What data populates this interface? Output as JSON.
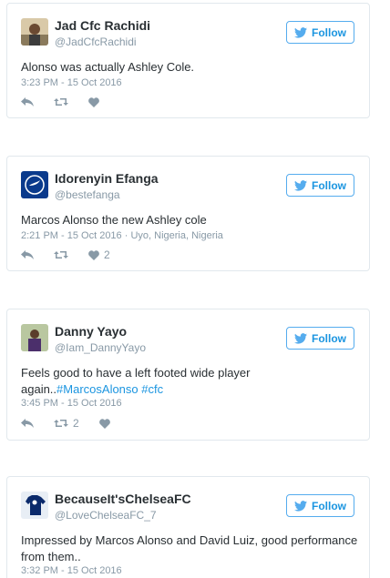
{
  "follow_label": "Follow",
  "colors": {
    "link": "#1b95e0",
    "muted": "#8899a6",
    "border": "#e1e8ed",
    "text": "#292f33"
  },
  "tweets": [
    {
      "name": "Jad Cfc Rachidi",
      "handle": "@JadCfcRachidi",
      "text_parts": [
        "Alonso was actually Ashley Cole."
      ],
      "meta": "3:23 PM - 15 Oct 2016",
      "retweet_count": "",
      "like_count": "",
      "avatar": "photo-avatar"
    },
    {
      "name": "Idorenyin Efanga",
      "handle": "@bestefanga",
      "text_parts": [
        "Marcos Alonso the new Ashley cole"
      ],
      "meta": "2:21 PM - 15 Oct 2016 · Uyo, Nigeria, Nigeria",
      "retweet_count": "",
      "like_count": "2",
      "avatar": "club-crest-avatar"
    },
    {
      "name": "Danny Yayo",
      "handle": "@Iam_DannyYayo",
      "text_line1": "Feels good to have a left footed wide player",
      "text_line2_prefix": "again..",
      "hashtag1": "#MarcosAlonso",
      "hashtag2": "#cfc",
      "meta": "3:45 PM - 15 Oct 2016",
      "retweet_count": "2",
      "like_count": "",
      "avatar": "photo-avatar"
    },
    {
      "name": "BecauseIt'sChelseaFC",
      "handle": "@LoveChelseaFC_7",
      "text_line1": "Impressed by Marcos Alonso and David Luiz, good performance",
      "text_line2": "from them..",
      "meta": "3:32 PM - 15 Oct 2016",
      "avatar": "shirt-avatar"
    }
  ]
}
